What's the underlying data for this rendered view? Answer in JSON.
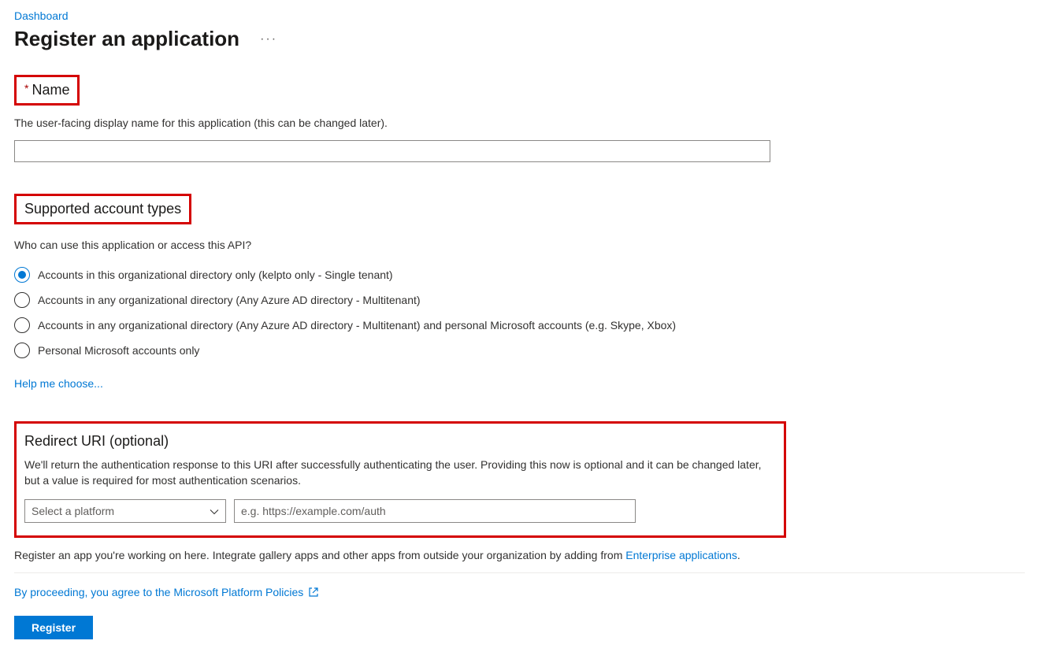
{
  "breadcrumb": {
    "dashboard": "Dashboard"
  },
  "page_title": "Register an application",
  "name_section": {
    "label": "Name",
    "help": "The user-facing display name for this application (this can be changed later).",
    "value": ""
  },
  "account_types": {
    "heading": "Supported account types",
    "question": "Who can use this application or access this API?",
    "options": [
      {
        "label": "Accounts in this organizational directory only (kelpto only - Single tenant)",
        "selected": true
      },
      {
        "label": "Accounts in any organizational directory (Any Azure AD directory - Multitenant)",
        "selected": false
      },
      {
        "label": "Accounts in any organizational directory (Any Azure AD directory - Multitenant) and personal Microsoft accounts (e.g. Skype, Xbox)",
        "selected": false
      },
      {
        "label": "Personal Microsoft accounts only",
        "selected": false
      }
    ],
    "help_link": "Help me choose..."
  },
  "redirect": {
    "heading": "Redirect URI (optional)",
    "description": "We'll return the authentication response to this URI after successfully authenticating the user. Providing this now is optional and it can be changed later, but a value is required for most authentication scenarios.",
    "platform_placeholder": "Select a platform",
    "uri_placeholder": "e.g. https://example.com/auth"
  },
  "footer": {
    "text_before": "Register an app you're working on here. Integrate gallery apps and other apps from outside your organization by adding from ",
    "link_text": "Enterprise applications",
    "text_after": "."
  },
  "policy": {
    "text": "By proceeding, you agree to the Microsoft Platform Policies"
  },
  "register_button": "Register"
}
